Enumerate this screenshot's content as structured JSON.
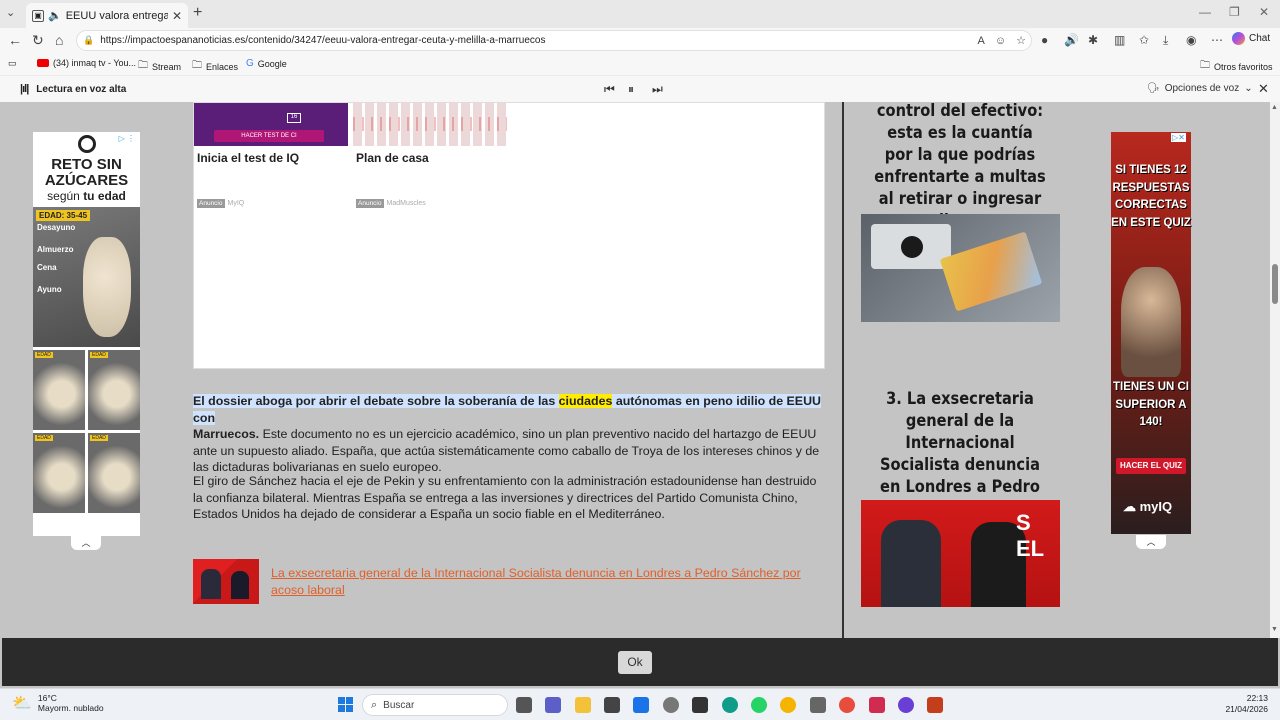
{
  "browser": {
    "tab_title": "EEUU valora entregar Ceuta y",
    "url": "https://impactoespananoticias.es/contenido/34247/eeuu-valora-entregar-ceuta-y-melilla-a-marruecos",
    "chat_label": "Chat",
    "bookmarks": [
      "(34) inmaq tv - You...",
      "Stream",
      "Enlaces",
      "Google"
    ],
    "other_favorites": "Otros favoritos"
  },
  "read_aloud": {
    "label": "Lectura en voz alta",
    "voice_options": "Opciones de voz"
  },
  "ad_left": {
    "headline": "RETO SIN AZÚCARES",
    "sub_pre": "según",
    "sub_bold": "tu edad",
    "age_badge": "EDAD: 35-45",
    "meals": [
      "Desayuno",
      "Almuerzo",
      "Cena",
      "Ayuno"
    ]
  },
  "ad_cards": [
    {
      "title": "Inicia el test de IQ",
      "tag": "Anuncio",
      "source": "MyIQ",
      "button": "HACER TEST DE CI",
      "number": "16"
    },
    {
      "title": "Plan de casa",
      "tag": "Anuncio",
      "source": "MadMuscles"
    }
  ],
  "article": {
    "p1_bold_a": "El dossier aboga por abrir el debate sobre la soberanía de las ",
    "p1_bold_hl": "ciudades",
    "p1_bold_b": " autónomas en peno idilio de EEUU con",
    "p1_bold_c": "Marruecos.",
    "p1_rest": " Este documento no es un ejercicio académico, sino un plan preventivo nacido del hartazgo de EEUU ante un supuesto aliado. España, que actúa sistemáticamente como caballo de Troya de los intereses chinos y de las dictaduras bolivarianas en suelo europeo.",
    "p2": "El giro de Sánchez hacia el eje de Pekin y su enfrentamiento con la administración estadounidense han destruido la confianza bilateral. Mientras España se entrega a las inversiones y directrices del Partido Comunista Chino, Estados Unidos ha dejado de considerar a España un socio fiable en el Mediterráneo.",
    "related_link": "La exsecretaria general de la Internacional Socialista denuncia en Londres a Pedro Sánchez por acoso laboral"
  },
  "sidebar": {
    "item2_title": "control del efectivo: esta es la cuantía por la que podrías enfrentarte a multas al retirar o ingresar dinero",
    "item3_title": "3. La exsecretaria general de la Internacional Socialista denuncia en Londres a Pedro Sánchez por acoso laboral"
  },
  "ad_right": {
    "text1": "SI TIENES 12 RESPUESTAS CORRECTAS EN ESTE QUIZ",
    "text2": "TIENES UN CI SUPERIOR A 140!",
    "button": "HACER EL QUIZ",
    "brand": "myIQ"
  },
  "cookie": {
    "ok_label": "Ok"
  },
  "taskbar": {
    "temp": "16°C",
    "weather": "Mayorm. nublado",
    "search_placeholder": "Buscar",
    "time": "22:13",
    "date": "21/04/2026"
  }
}
